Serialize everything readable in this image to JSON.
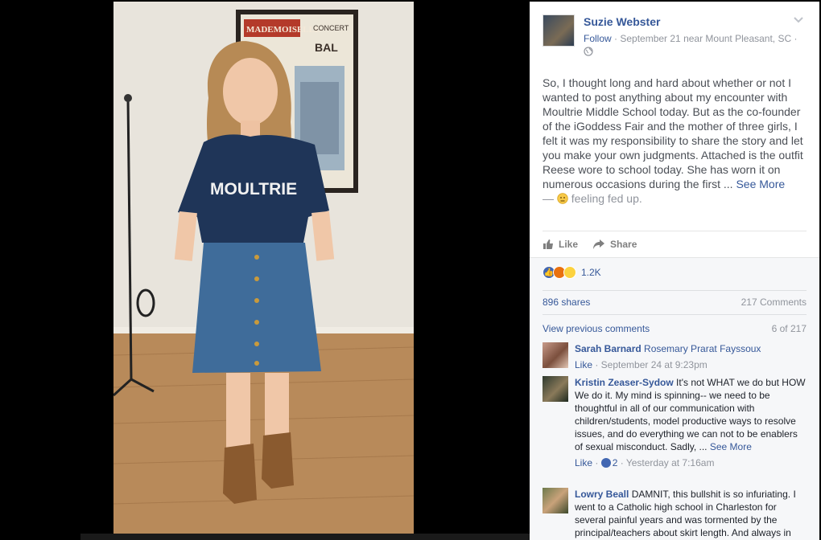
{
  "photo": {
    "poster_line1": "MADEMOISELLE",
    "poster_line2": "CONCERT",
    "poster_line3": "BAL",
    "shirt_text": "MOULTRIE"
  },
  "post": {
    "author": "Suzie Webster",
    "follow": "Follow",
    "meta": " · September 21 near Mount Pleasant, SC ·",
    "body": "So, I thought long and hard about whether or not I wanted to post anything about my encounter with Moultrie Middle School today. But as the co-founder of the iGoddess Fair and the mother of three girls, I felt it was my responsibility to share the story and let you make your own judgments. Attached is the outfit Reese wore to school today. She has worn it on numerous occasions during the first ... ",
    "see_more": "See More",
    "feeling_prefix": "— ",
    "feeling": " feeling fed up."
  },
  "actions": {
    "like": "Like",
    "share": "Share"
  },
  "feedback": {
    "reaction_count": "1.2K",
    "shares": "896 shares",
    "comments": "217 Comments",
    "view_previous": "View previous comments",
    "pager": "6 of 217"
  },
  "comments": [
    {
      "name": "Sarah Barnard",
      "tag": "Rosemary Prarat Fayssoux",
      "text": "",
      "see_more": "",
      "like": "Like",
      "reacts": "",
      "time": " · September 24 at 9:23pm"
    },
    {
      "name": "Kristin Zeaser-Sydow",
      "tag": "",
      "text": "It's not WHAT we do but HOW We do it. My mind is spinning-- we need to be thoughtful in all of our communication with children/students, model productive ways to resolve issues, and do everything we can not to be enablers of sexual misconduct. Sadly, ... ",
      "see_more": "See More",
      "like": "Like",
      "reacts": "2",
      "time": " · Yesterday at 7:16am"
    },
    {
      "name": "Lowry Beall",
      "tag": "",
      "text": "DAMNIT, this bullshit is so infuriating. I went to a Catholic high school in Charleston for several painful years and was tormented by the principal/teachers about skirt length. And always in",
      "see_more": "",
      "like": "",
      "reacts": "",
      "time": ""
    }
  ],
  "colors": {
    "link": "#365899",
    "meta": "#90949c",
    "feedback_bg": "#f6f7f9"
  }
}
